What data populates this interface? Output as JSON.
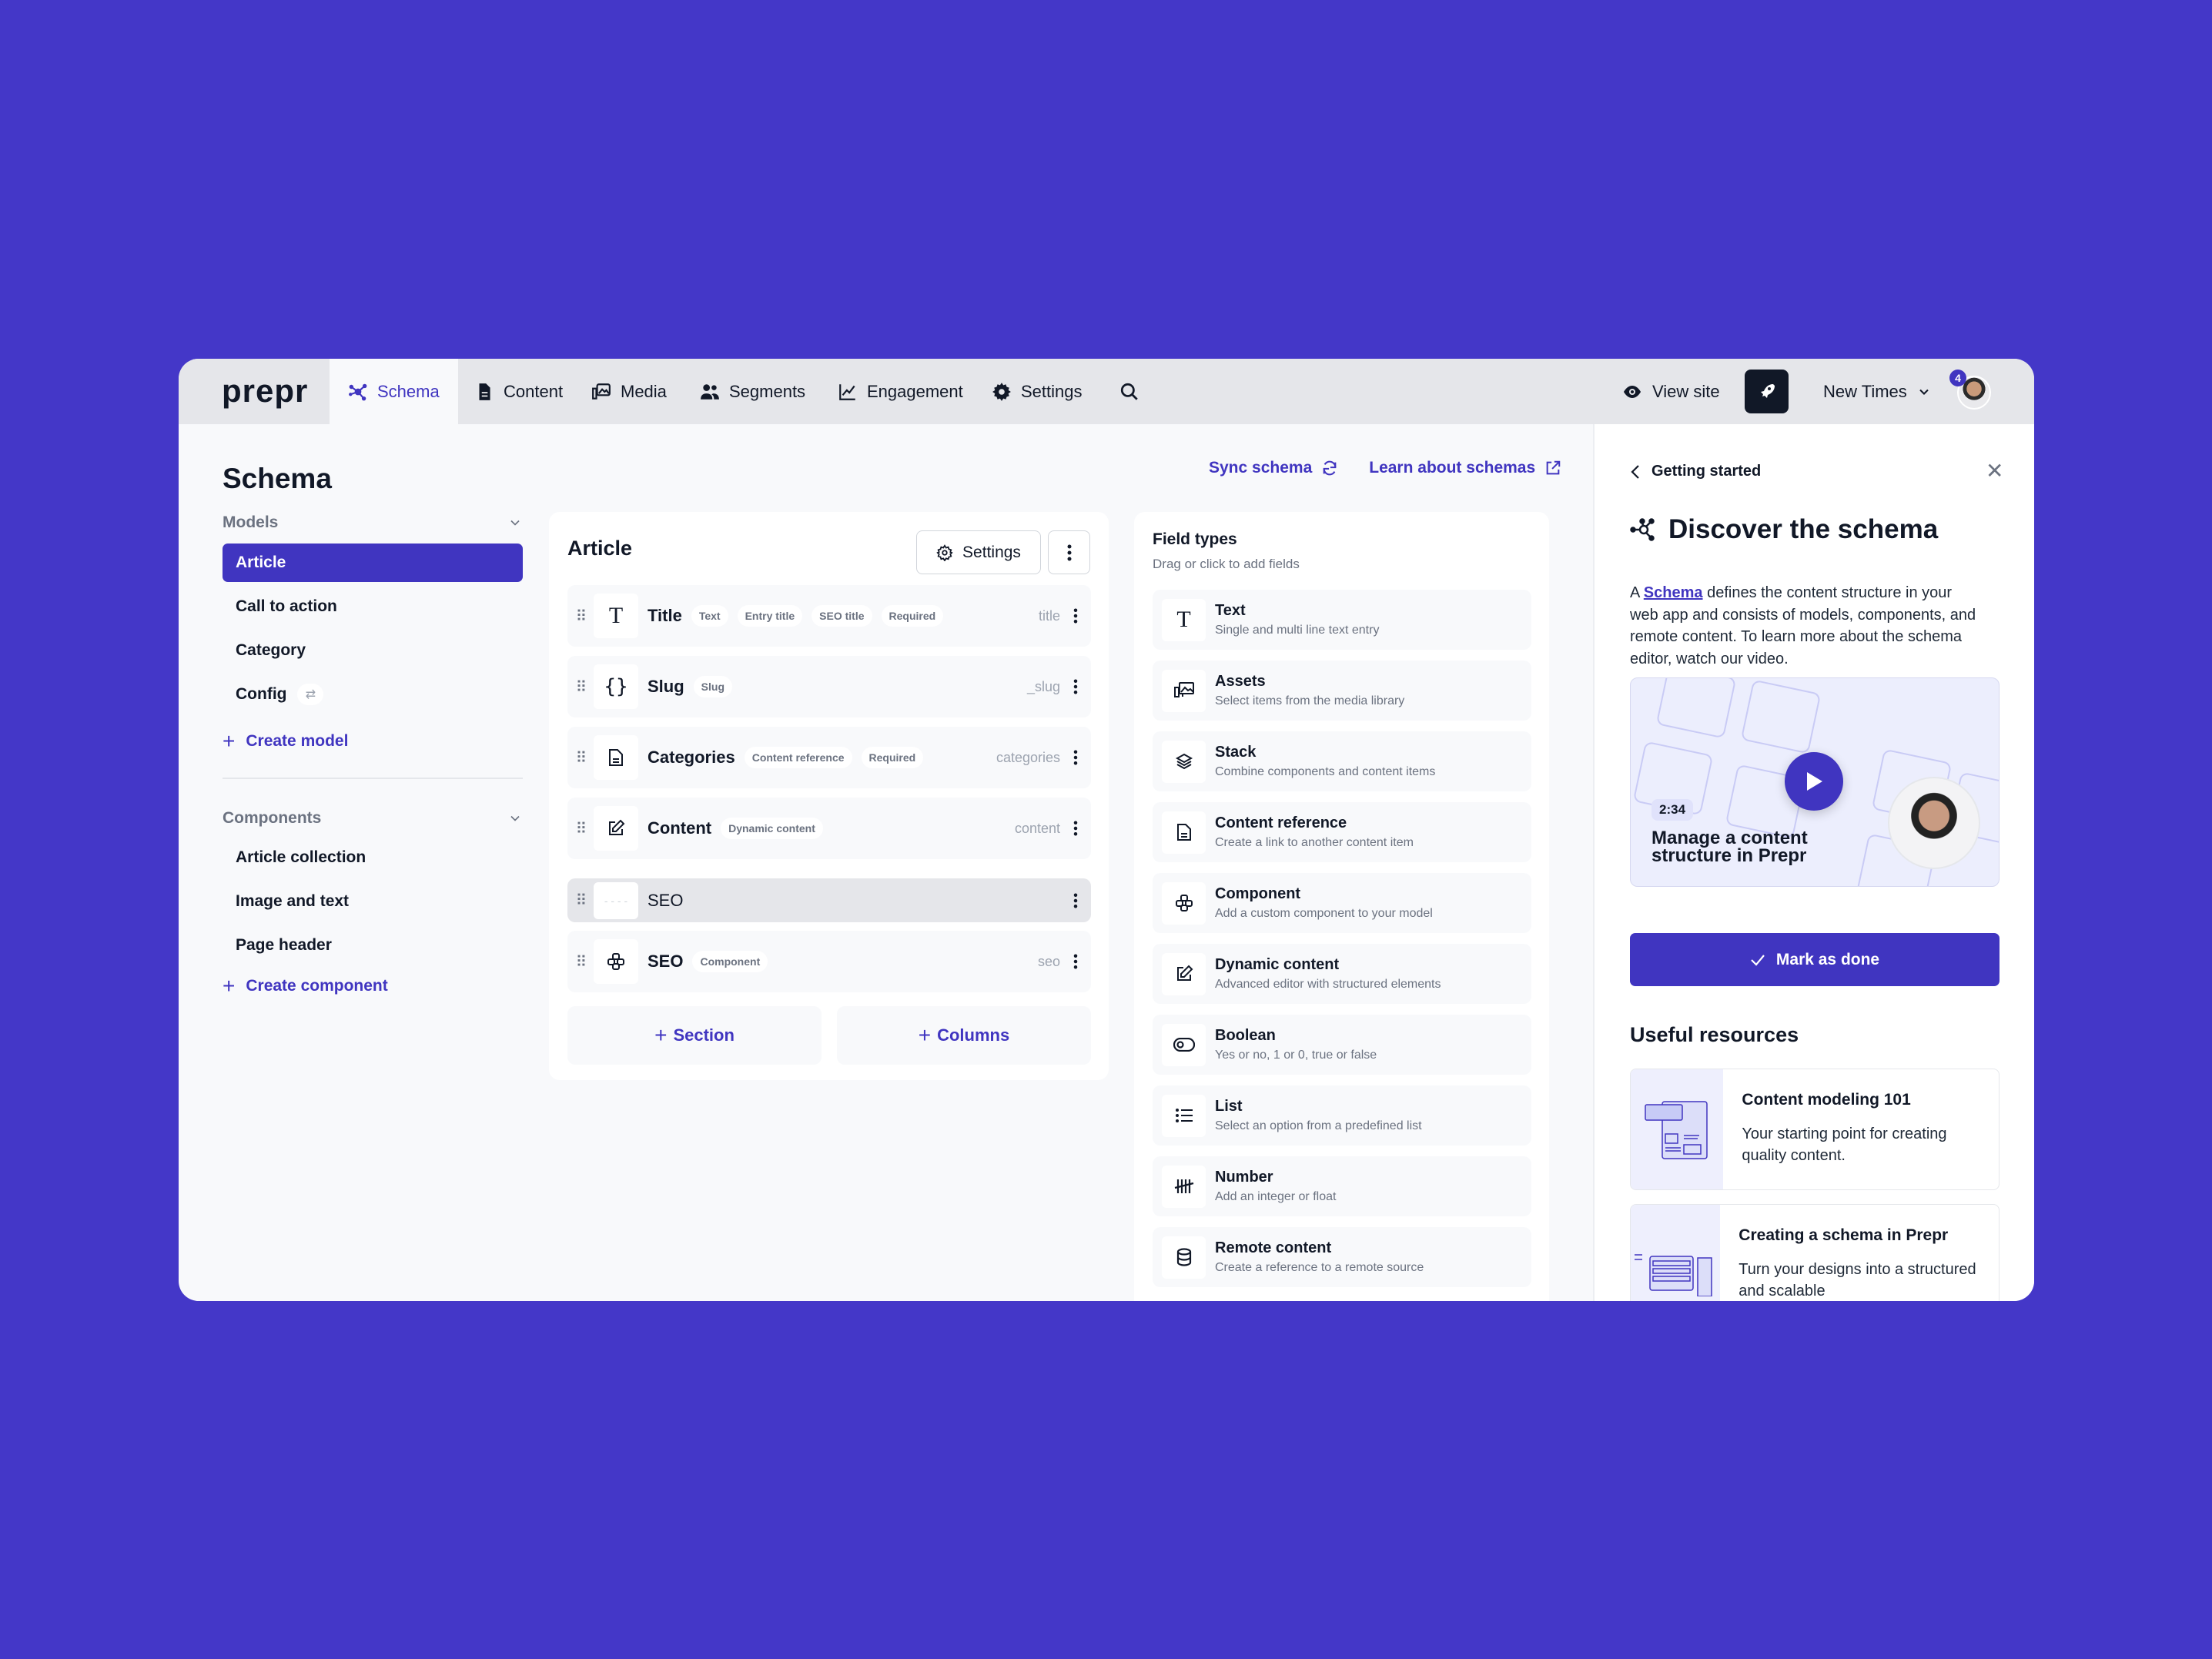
{
  "app": {
    "logo": "prepr"
  },
  "nav": {
    "items": [
      {
        "label": "Schema",
        "icon": "schema-icon",
        "active": true
      },
      {
        "label": "Content",
        "icon": "document-icon"
      },
      {
        "label": "Media",
        "icon": "media-icon"
      },
      {
        "label": "Segments",
        "icon": "users-icon"
      },
      {
        "label": "Engagement",
        "icon": "chart-icon"
      },
      {
        "label": "Settings",
        "icon": "gear-icon"
      }
    ],
    "search_icon": "search-icon",
    "view_site": "View site",
    "workspace": "New Times",
    "notification_count": "4"
  },
  "sidebar": {
    "title": "Schema",
    "models_heading": "Models",
    "models": [
      {
        "label": "Article",
        "active": true
      },
      {
        "label": "Call to action"
      },
      {
        "label": "Category"
      },
      {
        "label": "Config",
        "synced": true
      }
    ],
    "create_model": "Create model",
    "components_heading": "Components",
    "components": [
      {
        "label": "Article collection"
      },
      {
        "label": "Image and text"
      },
      {
        "label": "Page header"
      }
    ],
    "create_component": "Create component"
  },
  "toplinks": {
    "sync": "Sync schema",
    "learn": "Learn about schemas"
  },
  "editor": {
    "title": "Article",
    "settings_label": "Settings",
    "fields": [
      {
        "name": "Title",
        "icon": "text-icon",
        "tags": [
          "Text",
          "Entry title",
          "SEO title",
          "Required"
        ],
        "api_id": "title"
      },
      {
        "name": "Slug",
        "icon": "braces-icon",
        "tags": [
          "Slug"
        ],
        "api_id": "_slug"
      },
      {
        "name": "Categories",
        "icon": "document-icon",
        "tags": [
          "Content reference",
          "Required"
        ],
        "api_id": "categories"
      },
      {
        "name": "Content",
        "icon": "edit-icon",
        "tags": [
          "Dynamic content"
        ],
        "api_id": "content"
      },
      {
        "name": "SEO",
        "icon": "placeholder",
        "tags": [],
        "api_id": "",
        "dragging": true
      },
      {
        "name": "SEO",
        "icon": "component-icon",
        "tags": [
          "Component"
        ],
        "api_id": "seo"
      }
    ],
    "add_section": "Section",
    "add_columns": "Columns"
  },
  "field_types": {
    "title": "Field types",
    "subtitle": "Drag or click to add fields",
    "items": [
      {
        "name": "Text",
        "desc": "Single and multi line text entry",
        "icon": "text-icon"
      },
      {
        "name": "Assets",
        "desc": "Select items from the media library",
        "icon": "media-icon"
      },
      {
        "name": "Stack",
        "desc": "Combine components and content items",
        "icon": "layers-icon"
      },
      {
        "name": "Content reference",
        "desc": "Create a link to another content item",
        "icon": "document-icon"
      },
      {
        "name": "Component",
        "desc": "Add a custom component to your model",
        "icon": "component-icon"
      },
      {
        "name": "Dynamic content",
        "desc": "Advanced editor with structured elements",
        "icon": "edit-icon"
      },
      {
        "name": "Boolean",
        "desc": "Yes or no, 1 or 0, true or false",
        "icon": "toggle-icon"
      },
      {
        "name": "List",
        "desc": "Select an option from a predefined list",
        "icon": "list-icon"
      },
      {
        "name": "Number",
        "desc": "Add an integer or float",
        "icon": "tally-icon"
      },
      {
        "name": "Remote content",
        "desc": "Create a reference to a remote source",
        "icon": "database-icon"
      }
    ]
  },
  "guide": {
    "back_label": "Getting started",
    "title": "Discover the schema",
    "body_prefix": "A ",
    "body_link": "Schema",
    "body_suffix": " defines the content structure in your web app and consists of models, components, and remote content. To learn more about the schema editor, watch our video.",
    "video": {
      "duration": "2:34",
      "title": "Manage a content structure in Prepr"
    },
    "mark_done": "Mark as done",
    "resources_title": "Useful resources",
    "resources": [
      {
        "title": "Content modeling 101",
        "desc": "Your starting point for creating quality content."
      },
      {
        "title": "Creating a schema in Prepr",
        "desc": "Turn your designs into a structured and scalable"
      }
    ]
  },
  "colors": {
    "brand": "#4035c0",
    "background": "#4437c8",
    "text": "#111827",
    "muted": "#6b7280"
  }
}
